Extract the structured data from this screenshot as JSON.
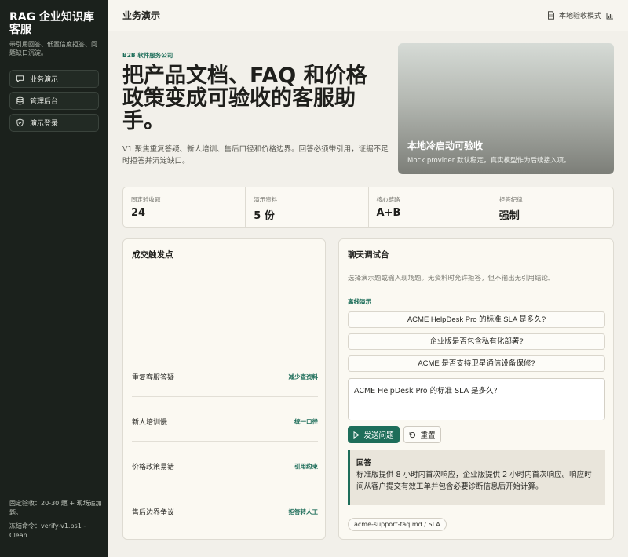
{
  "sidebar": {
    "title": "RAG 企业知识库客服",
    "subtitle": "带引用回答、低置信度拒答、问题缺口沉淀。",
    "items": [
      {
        "label": "业务演示",
        "icon": "chat-icon"
      },
      {
        "label": "管理后台",
        "icon": "database-icon"
      },
      {
        "label": "演示登录",
        "icon": "shield-icon"
      }
    ],
    "footer_acceptance": "固定验收：20-30 题 + 现场追加题。",
    "footer_command": "冻结命令：verify-v1.ps1 -Clean"
  },
  "header": {
    "title": "业务演示",
    "mode_label": "本地验收模式",
    "mode_icon": "document-icon",
    "chart_icon": "bar-chart-icon"
  },
  "hero": {
    "eyebrow": "B2B 软件服务公司",
    "title": "把产品文档、FAQ 和价格政策变成可验收的客服助手。",
    "description": "V1 聚焦重复答疑、新人培训、售后口径和价格边界。回答必须带引用，证据不足时拒答并沉淀缺口。",
    "image_title": "本地冷启动可验收",
    "image_subtitle": "Mock provider 默认稳定，真实模型作为后续接入项。"
  },
  "stats": [
    {
      "label": "固定验收题",
      "value": "24"
    },
    {
      "label": "演示资料",
      "value": "5 份"
    },
    {
      "label": "核心链路",
      "value": "A+B"
    },
    {
      "label": "拒答纪律",
      "value": "强制"
    }
  ],
  "triggers": {
    "title": "成交触发点",
    "items": [
      {
        "label": "重复客服答疑",
        "tag": "减少查资料"
      },
      {
        "label": "新人培训慢",
        "tag": "统一口径"
      },
      {
        "label": "价格政策易错",
        "tag": "引用约束"
      },
      {
        "label": "售后边界争议",
        "tag": "拒答转人工"
      }
    ]
  },
  "chat": {
    "title": "聊天调试台",
    "description": "选择演示题或输入现场题。无资料时允许拒答，但不输出无引用结论。",
    "presets_hint": "离线演示",
    "presets": [
      "ACME HelpDesk Pro 的标准 SLA 是多久?",
      "企业版是否包含私有化部署?",
      "ACME 是否支持卫星通信设备保修?"
    ],
    "input_value": "ACME HelpDesk Pro 的标准 SLA 是多久?",
    "send_label": "发送问题",
    "reset_label": "重置",
    "answer_title": "回答",
    "answer_body": "标准版提供 8 小时内首次响应，企业版提供 2 小时内首次响应。响应时间从客户提交有效工单并包含必要诊断信息后开始计算。",
    "citation": "acme-support-faq.md / SLA"
  },
  "colors": {
    "accent": "#1e6e5a",
    "sidebar_bg": "#1b211c",
    "page_bg": "#f2f0ea"
  }
}
